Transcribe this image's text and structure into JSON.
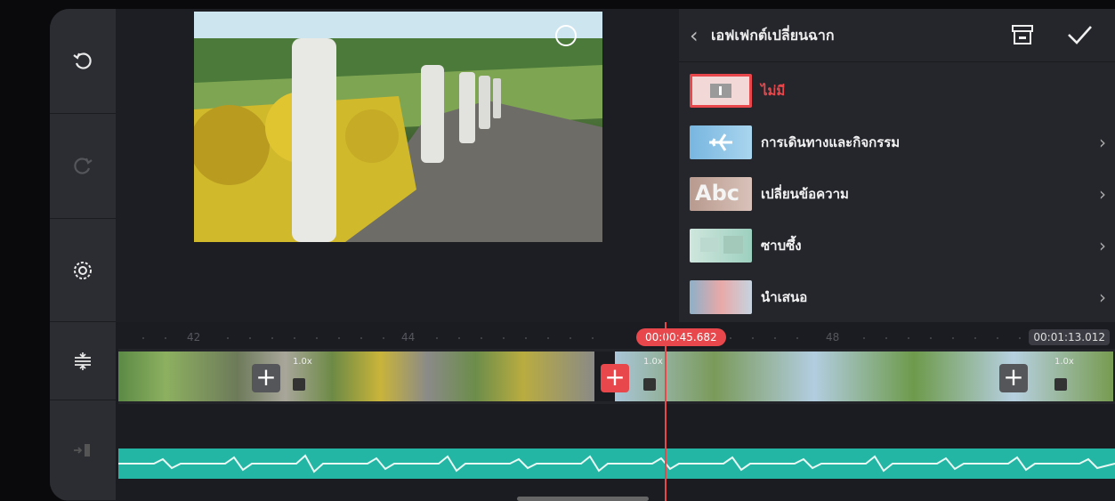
{
  "panel": {
    "title": "เอฟเฟกต์เปลี่ยนฉาก",
    "items": [
      {
        "label": "ไม่มี",
        "color": "#e8474b"
      },
      {
        "label": "การเดินทางและกิจกรรม"
      },
      {
        "label": "เปลี่ยนข้อความ",
        "thumb_text": "Abc"
      },
      {
        "label": "ซาบซึ้ง"
      },
      {
        "label": "นำเสนอ"
      }
    ]
  },
  "timeline": {
    "ruler_labels": [
      "42",
      "44",
      "48"
    ],
    "current_time": "00:00:45.682",
    "total_time": "00:01:13.012",
    "clip_speeds": [
      "1.0x",
      "1.0x",
      "1.0x"
    ]
  },
  "icons": {
    "toolbar": [
      "undo-icon",
      "redo-icon",
      "settings-icon",
      "split-icon",
      "track-icon"
    ]
  },
  "colors": {
    "accent": "#e8474b",
    "audio": "#23b6a5"
  }
}
